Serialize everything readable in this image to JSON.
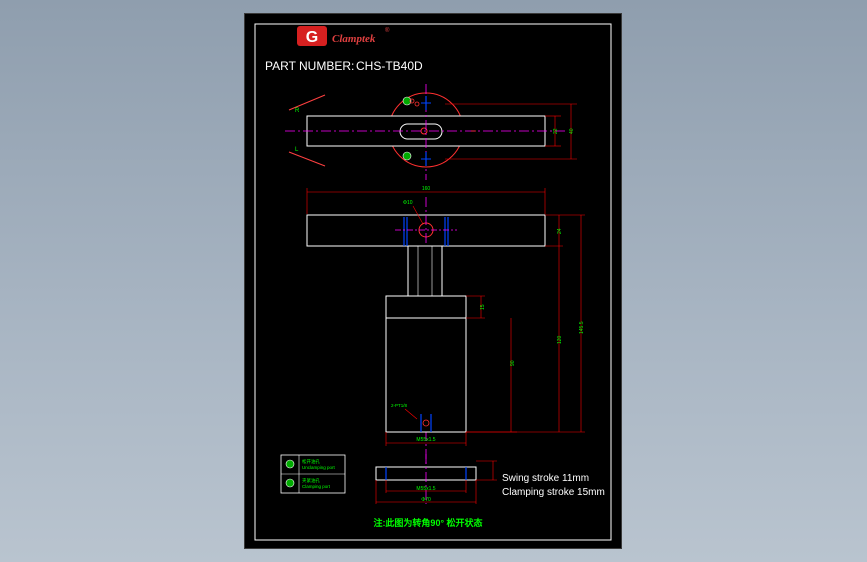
{
  "drawing": {
    "brand": "Clamptek",
    "brand_logo_letter": "G",
    "registered_mark": "®",
    "part_label": "PART NUMBER:",
    "part_number": "CHS-TB40D",
    "side_labels": {
      "right": "R",
      "left": "L"
    },
    "top_view_dims": {
      "inner": "22",
      "outer": "40"
    },
    "front_view_dims": {
      "overall_length": "160",
      "pin_dia": "Φ10",
      "arm_height": "24",
      "body_top": "15",
      "body_height": "90",
      "base_to_arm": "120",
      "overall_height": "145.5",
      "port": "2-PT1/8",
      "body_thread": "M55x1.5"
    },
    "bottom_view_dims": {
      "thread": "M55x1.5",
      "dia": "Φ70"
    },
    "legend": {
      "item1_cn": "松开油孔",
      "item1_en": "Unclamping port",
      "item2_cn": "夹紧油孔",
      "item2_en": "Clamping port"
    },
    "notes": {
      "swing": "Swing stroke 11mm",
      "clamp": "Clamping stroke 15mm"
    },
    "footnote": "注:此图为转角90° 松开状态"
  },
  "colors": {
    "background": "#000000",
    "outline": "#ffffff",
    "dimension": "#ff0000",
    "centerline": "#ff00ff",
    "hidden": "#0000ff",
    "annotation": "#00ff00",
    "circle": "#ff3030"
  }
}
